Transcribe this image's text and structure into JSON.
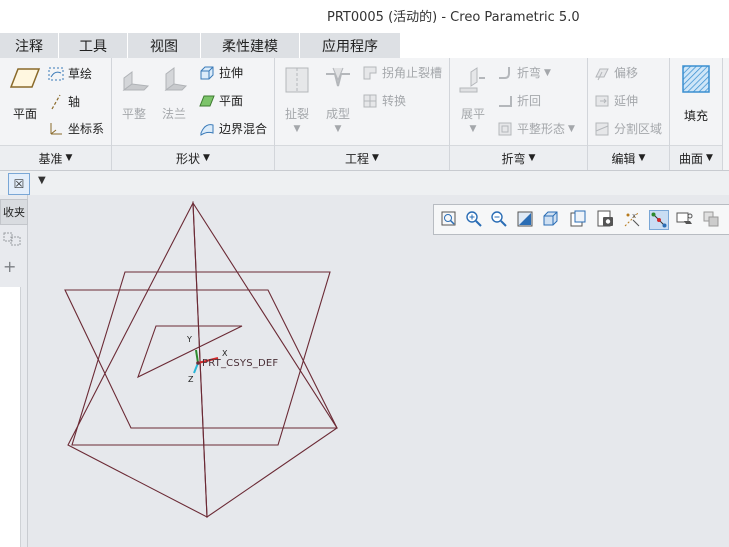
{
  "window": {
    "title": "PRT0005 (活动的) - Creo Parametric 5.0"
  },
  "tabs": [
    "注释",
    "工具",
    "视图",
    "柔性建模",
    "应用程序"
  ],
  "ribbon": {
    "datum": {
      "plane_label": "平面",
      "sketch_label": "草绘",
      "axis_label": "轴",
      "csys_label": "坐标系",
      "group_label": "基准"
    },
    "shapes": {
      "flat_label": "平整",
      "flange_label": "法兰",
      "extrude_label": "拉伸",
      "planar_label": "平面",
      "boundary_blend_label": "边界混合",
      "group_label": "形状"
    },
    "engineering": {
      "rip_label": "扯裂",
      "form_label": "成型",
      "corner_relief_label": "拐角止裂槽",
      "convert_label": "转换",
      "group_label": "工程"
    },
    "bends": {
      "unbend_label": "展平",
      "bend_label": "折弯",
      "bend_back_label": "折回",
      "flat_pattern_label": "平整形态",
      "group_label": "折弯"
    },
    "editing": {
      "offset_label": "偏移",
      "extend_label": "延伸",
      "split_area_label": "分割区域",
      "group_label": "编辑"
    },
    "surfaces": {
      "fill_label": "填充",
      "group_label": "曲面"
    }
  },
  "left_panel": {
    "tab_label": "收夹"
  },
  "viewport": {
    "csys_label": "PRT_CSYS_DEF",
    "axis_x": "X",
    "axis_y": "Y",
    "axis_z": "Z",
    "geometry_color": "#6b2a35"
  },
  "view_toolbar": {
    "icons": [
      "refit-icon",
      "zoom-in-icon",
      "zoom-out-icon",
      "repaint-icon",
      "display-style-icon",
      "saved-orientations-icon",
      "view-manager-icon",
      "perspective-icon",
      "datum-display-icon",
      "spin-center-icon",
      "annotation-display-icon",
      "appearance-icon"
    ]
  }
}
